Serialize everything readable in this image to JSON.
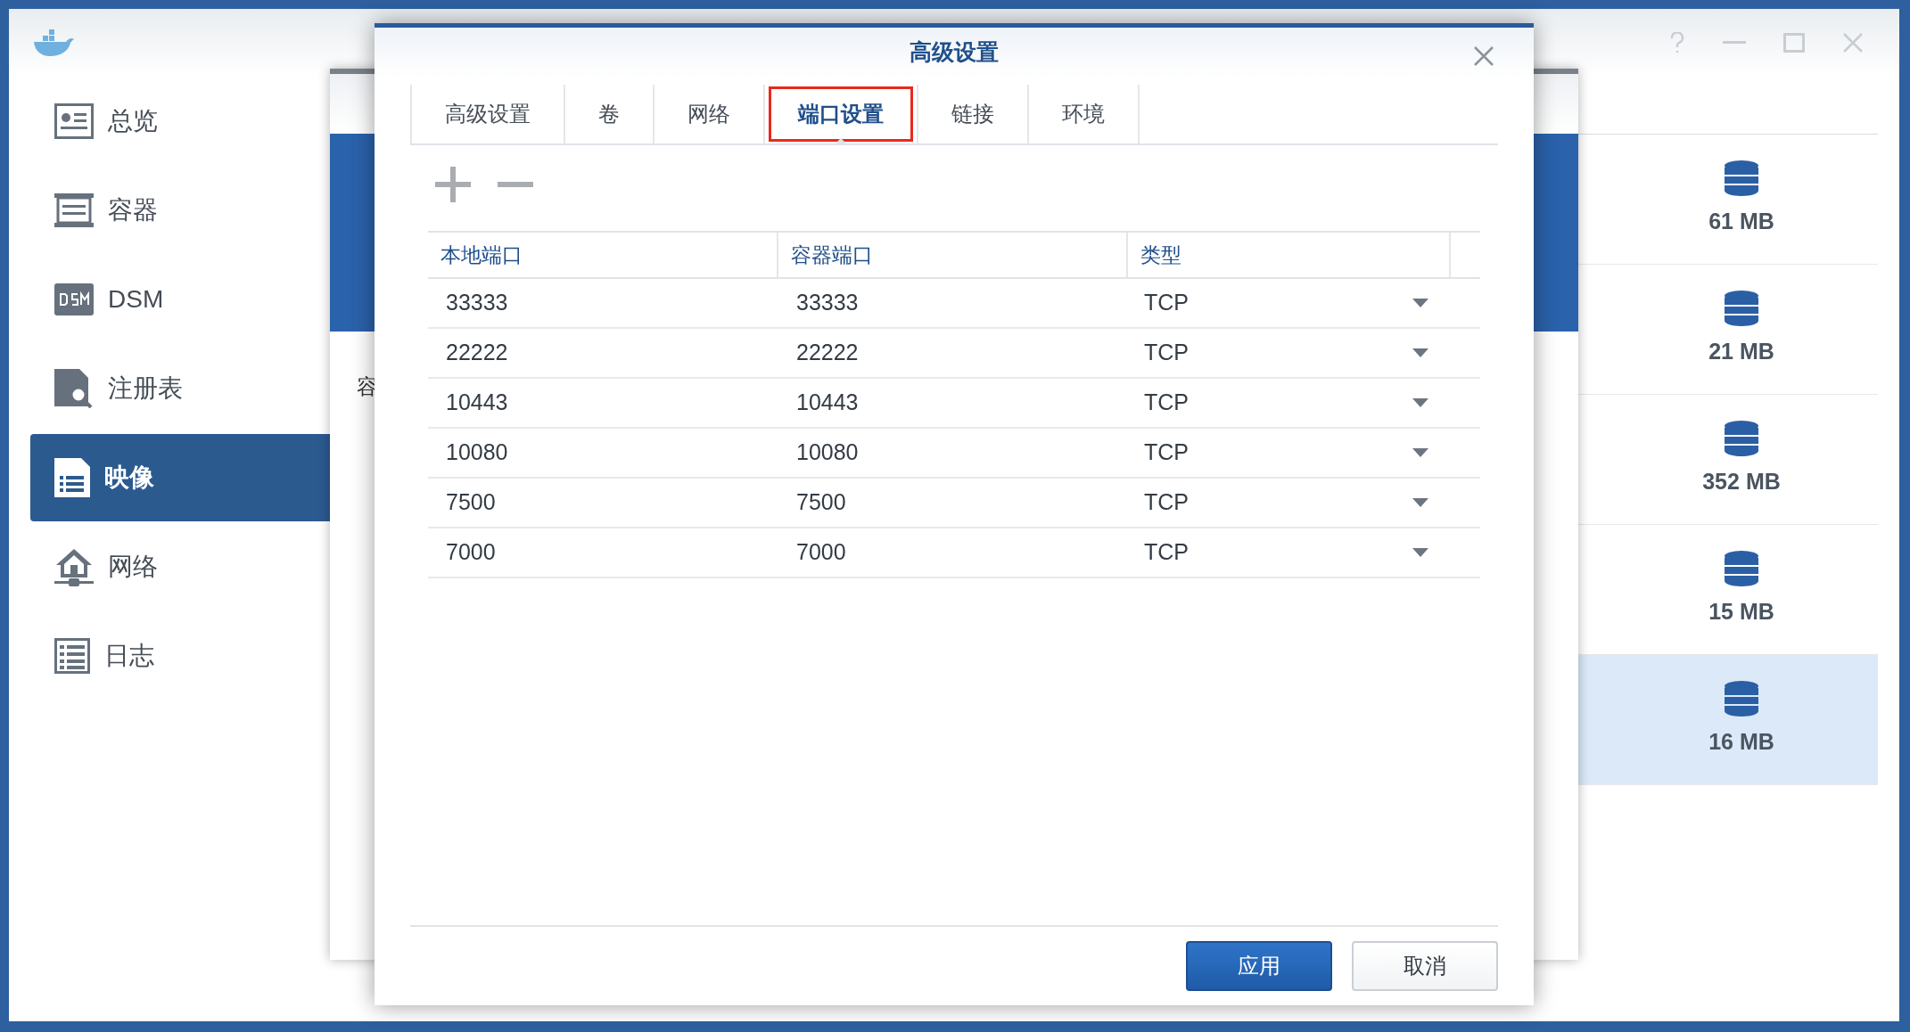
{
  "sidebar": {
    "items": [
      {
        "label": "总览",
        "selected": false
      },
      {
        "label": "容器",
        "selected": false
      },
      {
        "label": "DSM",
        "selected": false
      },
      {
        "label": "注册表",
        "selected": false
      },
      {
        "label": "映像",
        "selected": true
      },
      {
        "label": "网络",
        "selected": false
      },
      {
        "label": "日志",
        "selected": false
      }
    ]
  },
  "background_dialog": {
    "label": "容"
  },
  "image_list": {
    "rows": [
      {
        "size": "61 MB",
        "selected": false
      },
      {
        "size": "21 MB",
        "selected": false
      },
      {
        "size": "352 MB",
        "selected": false
      },
      {
        "size": "15 MB",
        "selected": false
      },
      {
        "size": "16 MB",
        "selected": true
      }
    ]
  },
  "dialog": {
    "title": "高级设置",
    "tabs": [
      {
        "label": "高级设置",
        "selected": false,
        "highlighted": false
      },
      {
        "label": "卷",
        "selected": false,
        "highlighted": false
      },
      {
        "label": "网络",
        "selected": false,
        "highlighted": false
      },
      {
        "label": "端口设置",
        "selected": true,
        "highlighted": true
      },
      {
        "label": "链接",
        "selected": false,
        "highlighted": false
      },
      {
        "label": "环境",
        "selected": false,
        "highlighted": false
      }
    ],
    "table": {
      "columns": [
        "本地端口",
        "容器端口",
        "类型"
      ],
      "rows": [
        {
          "local_port": "33333",
          "container_port": "33333",
          "type": "TCP"
        },
        {
          "local_port": "22222",
          "container_port": "22222",
          "type": "TCP"
        },
        {
          "local_port": "10443",
          "container_port": "10443",
          "type": "TCP"
        },
        {
          "local_port": "10080",
          "container_port": "10080",
          "type": "TCP"
        },
        {
          "local_port": "7500",
          "container_port": "7500",
          "type": "TCP"
        },
        {
          "local_port": "7000",
          "container_port": "7000",
          "type": "TCP"
        }
      ]
    },
    "buttons": [
      {
        "label": "应用",
        "kind": "primary"
      },
      {
        "label": "取消",
        "kind": "secondary"
      }
    ]
  }
}
